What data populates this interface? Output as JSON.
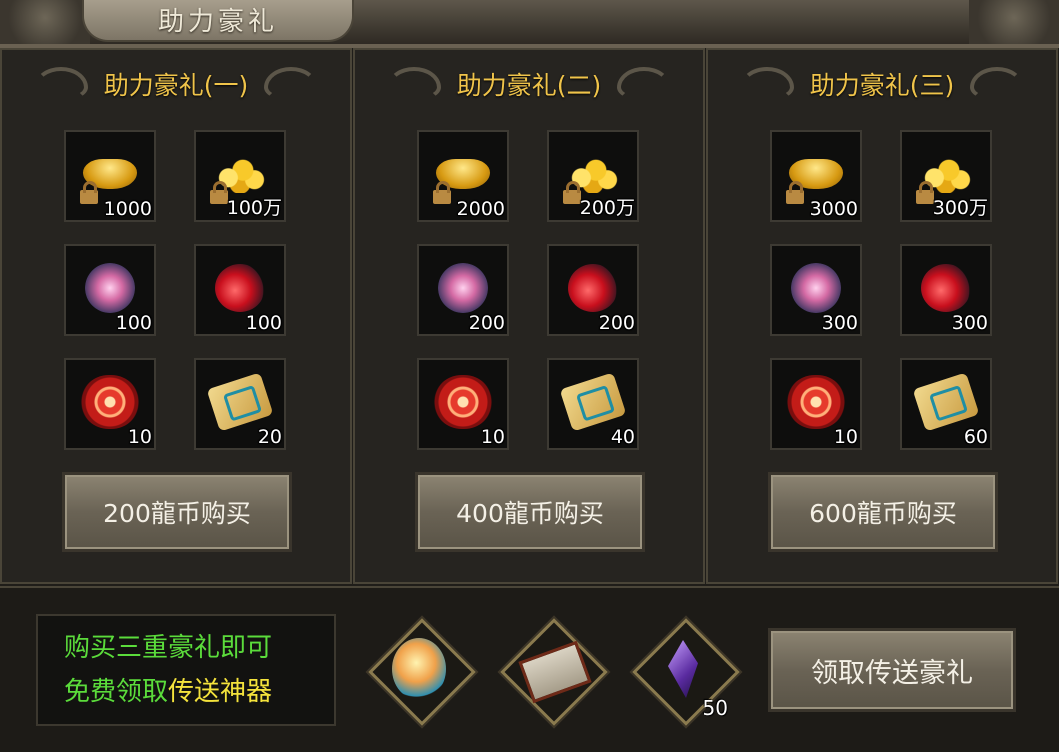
{
  "window": {
    "title": "助力豪礼"
  },
  "panels": [
    {
      "title": "助力豪礼(一)",
      "items": [
        {
          "icon": "bound-gold-ingot-icon",
          "qty": "1000"
        },
        {
          "icon": "bound-gold-coins-icon",
          "qty": "100万"
        },
        {
          "icon": "pink-soul-orb-icon",
          "qty": "100"
        },
        {
          "icon": "red-soul-orb-icon",
          "qty": "100"
        },
        {
          "icon": "red-swirl-gem-icon",
          "qty": "10"
        },
        {
          "icon": "scroll-icon",
          "qty": "20"
        }
      ],
      "button": "200龍币购买"
    },
    {
      "title": "助力豪礼(二)",
      "items": [
        {
          "icon": "bound-gold-ingot-icon",
          "qty": "2000"
        },
        {
          "icon": "bound-gold-coins-icon",
          "qty": "200万"
        },
        {
          "icon": "pink-soul-orb-icon",
          "qty": "200"
        },
        {
          "icon": "red-soul-orb-icon",
          "qty": "200"
        },
        {
          "icon": "red-swirl-gem-icon",
          "qty": "10"
        },
        {
          "icon": "scroll-icon",
          "qty": "40"
        }
      ],
      "button": "400龍币购买"
    },
    {
      "title": "助力豪礼(三)",
      "items": [
        {
          "icon": "bound-gold-ingot-icon",
          "qty": "3000"
        },
        {
          "icon": "bound-gold-coins-icon",
          "qty": "300万"
        },
        {
          "icon": "pink-soul-orb-icon",
          "qty": "300"
        },
        {
          "icon": "red-soul-orb-icon",
          "qty": "300"
        },
        {
          "icon": "red-swirl-gem-icon",
          "qty": "10"
        },
        {
          "icon": "scroll-icon",
          "qty": "60"
        }
      ],
      "button": "600龍币购买"
    }
  ],
  "promo": {
    "line1": "购买三重豪礼即可",
    "line2_green": "免费领取",
    "line2_yellow": "传送神器"
  },
  "rewards": [
    {
      "icon": "spirit-flame-icon",
      "qty": ""
    },
    {
      "icon": "map-scroll-icon",
      "qty": ""
    },
    {
      "icon": "purple-crystal-icon",
      "qty": "50"
    }
  ],
  "claim_button": "领取传送豪礼",
  "colors": {
    "title_gold": "#f0c44a",
    "promo_green": "#5bdc3b",
    "promo_yellow": "#f4e33c"
  }
}
